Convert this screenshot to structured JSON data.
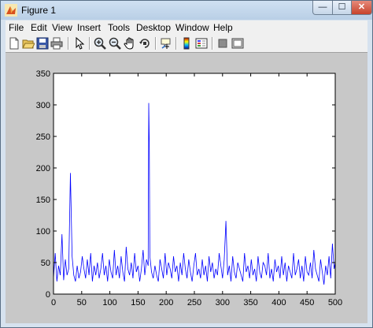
{
  "window": {
    "title": "Figure 1",
    "controls": {
      "minimize": "—",
      "maximize": "☐",
      "close": "✕"
    }
  },
  "menu": [
    "File",
    "Edit",
    "View",
    "Insert",
    "Tools",
    "Desktop",
    "Window",
    "Help"
  ],
  "toolbar": [
    "new-figure-icon",
    "open-file-icon",
    "save-icon",
    "print-icon",
    "edit-plot-icon",
    "zoom-in-icon",
    "zoom-out-icon",
    "pan-icon",
    "rotate-3d-icon",
    "data-cursor-icon",
    "insert-colorbar-icon",
    "insert-legend-icon",
    "hide-plot-tools-icon",
    "show-plot-tools-icon"
  ],
  "colors": {
    "line": "#0000ff",
    "figure_bg": "#c8c8c8",
    "axes_bg": "#ffffff"
  },
  "chart_data": {
    "type": "line",
    "xlim": [
      0,
      500
    ],
    "ylim": [
      0,
      350
    ],
    "xticks": [
      0,
      50,
      100,
      150,
      200,
      250,
      300,
      350,
      400,
      450,
      500
    ],
    "yticks": [
      0,
      50,
      100,
      150,
      200,
      250,
      300,
      350
    ],
    "grid": false,
    "series": [
      {
        "x": [
          0,
          3,
          6,
          9,
          12,
          15,
          18,
          21,
          24,
          27,
          30,
          33,
          36,
          39,
          42,
          45,
          48,
          51,
          54,
          57,
          60,
          63,
          66,
          69,
          72,
          75,
          78,
          81,
          84,
          87,
          90,
          93,
          96,
          99,
          102,
          105,
          108,
          111,
          114,
          117,
          120,
          123,
          126,
          129,
          132,
          135,
          138,
          141,
          144,
          147,
          150,
          153,
          156,
          159,
          162,
          165,
          168,
          169,
          170,
          171,
          174,
          177,
          180,
          183,
          186,
          189,
          192,
          195,
          198,
          201,
          204,
          207,
          210,
          213,
          216,
          219,
          222,
          225,
          228,
          231,
          234,
          237,
          240,
          243,
          246,
          249,
          252,
          255,
          258,
          261,
          264,
          267,
          270,
          273,
          276,
          279,
          282,
          285,
          288,
          291,
          294,
          297,
          300,
          303,
          306,
          309,
          312,
          315,
          318,
          321,
          324,
          327,
          330,
          333,
          336,
          339,
          342,
          345,
          348,
          351,
          354,
          357,
          360,
          363,
          366,
          369,
          372,
          375,
          378,
          381,
          384,
          387,
          390,
          393,
          396,
          399,
          402,
          405,
          408,
          411,
          414,
          417,
          420,
          423,
          426,
          429,
          432,
          435,
          438,
          441,
          444,
          447,
          450,
          453,
          456,
          459,
          462,
          465,
          468,
          471,
          474,
          477,
          480,
          483,
          486,
          489,
          492,
          495,
          498,
          500
        ],
        "values": [
          25,
          65,
          20,
          45,
          30,
          95,
          22,
          55,
          30,
          40,
          192,
          60,
          30,
          20,
          45,
          25,
          35,
          60,
          40,
          25,
          55,
          30,
          65,
          20,
          45,
          30,
          50,
          25,
          40,
          65,
          30,
          45,
          20,
          55,
          35,
          25,
          70,
          30,
          45,
          25,
          60,
          35,
          20,
          75,
          40,
          30,
          50,
          25,
          65,
          35,
          45,
          20,
          40,
          70,
          30,
          55,
          45,
          303,
          240,
          60,
          35,
          25,
          45,
          30,
          20,
          55,
          40,
          25,
          65,
          30,
          50,
          40,
          25,
          60,
          35,
          45,
          20,
          50,
          30,
          65,
          40,
          25,
          55,
          35,
          20,
          45,
          65,
          30,
          40,
          25,
          55,
          30,
          45,
          20,
          60,
          35,
          50,
          25,
          40,
          30,
          65,
          45,
          25,
          55,
          116,
          30,
          45,
          20,
          60,
          35,
          25,
          50,
          40,
          30,
          20,
          65,
          35,
          45,
          25,
          55,
          30,
          40,
          20,
          60,
          35,
          25,
          50,
          45,
          30,
          65,
          25,
          40,
          20,
          55,
          35,
          45,
          25,
          60,
          30,
          50,
          20,
          45,
          35,
          25,
          65,
          30,
          40,
          55,
          25,
          45,
          20,
          60,
          35,
          30,
          50,
          25,
          70,
          40,
          30,
          20,
          55,
          35,
          15,
          45,
          30,
          60,
          25,
          80,
          40,
          50
        ]
      }
    ]
  }
}
